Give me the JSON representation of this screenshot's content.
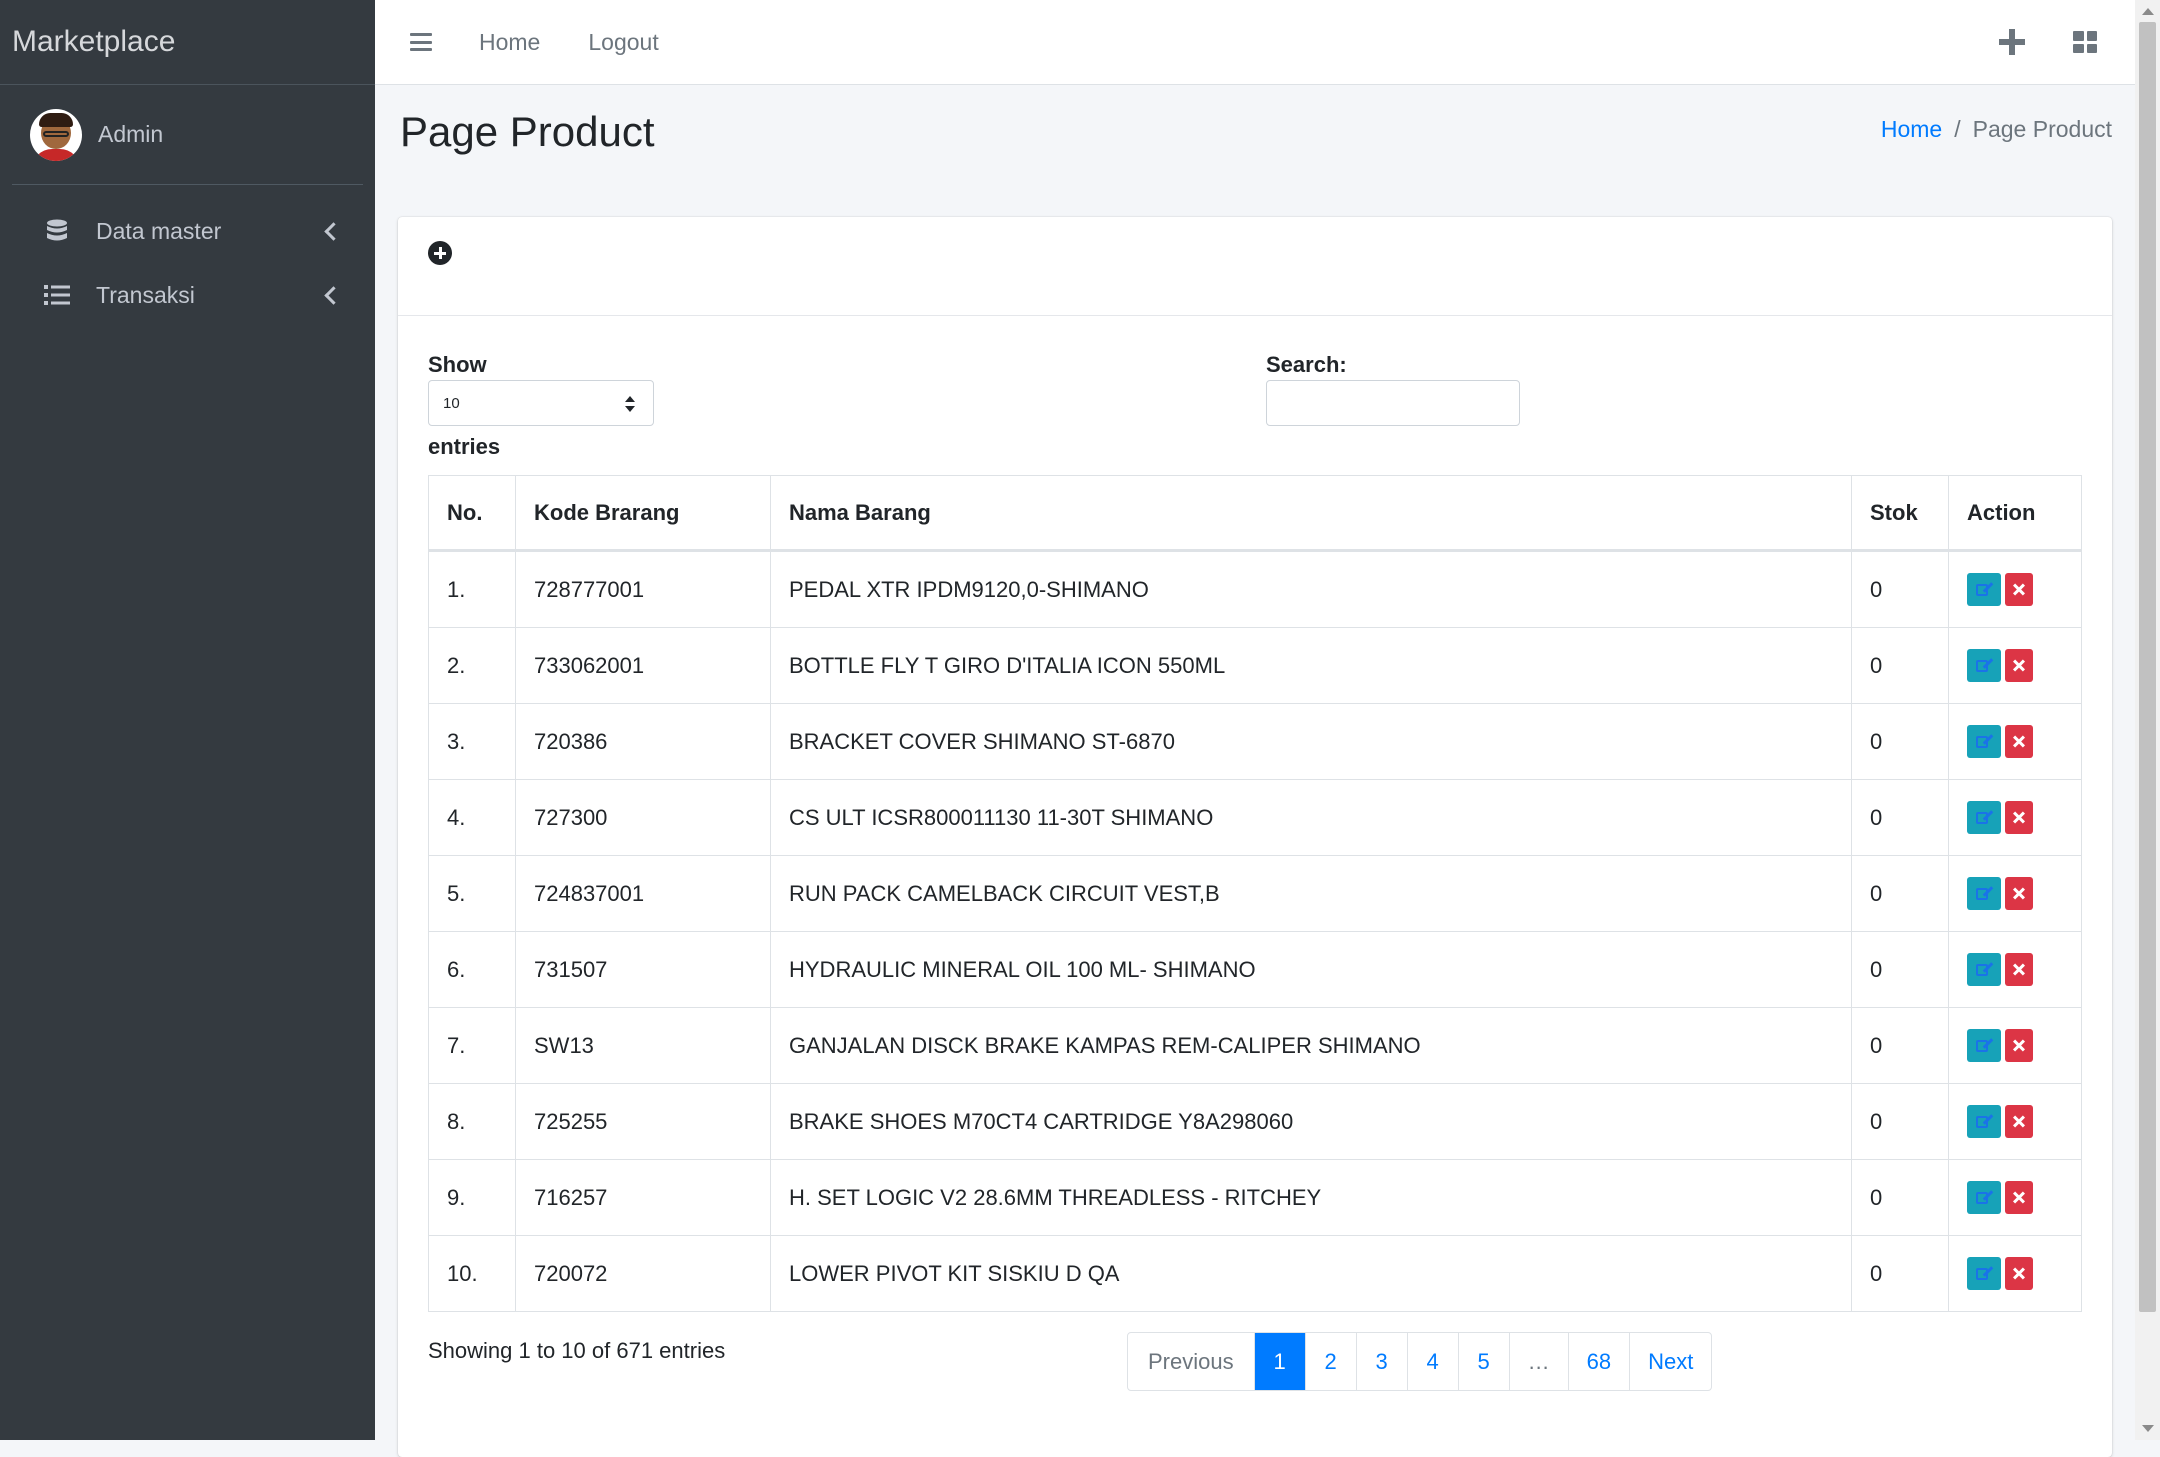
{
  "app": {
    "brand": "Marketplace"
  },
  "user": {
    "name": "Admin"
  },
  "sidebar": {
    "items": [
      {
        "label": "Data master"
      },
      {
        "label": "Transaksi"
      }
    ]
  },
  "topnav": {
    "links": [
      {
        "label": "Home"
      },
      {
        "label": "Logout"
      }
    ]
  },
  "page": {
    "title": "Page Product"
  },
  "breadcrumb": {
    "home": "Home",
    "sep": "/",
    "current": "Page Product"
  },
  "table_controls": {
    "show_label": "Show",
    "length_value": "10",
    "entries_label": "entries",
    "search_label": "Search:",
    "search_value": ""
  },
  "table": {
    "headers": [
      "No.",
      "Kode Brarang",
      "Nama Barang",
      "Stok",
      "Action"
    ],
    "rows": [
      {
        "no": "1.",
        "kode": "728777001",
        "nama": "PEDAL XTR IPDM9120,0-SHIMANO",
        "stok": "0"
      },
      {
        "no": "2.",
        "kode": "733062001",
        "nama": "BOTTLE FLY T GIRO D'ITALIA ICON 550ML",
        "stok": "0"
      },
      {
        "no": "3.",
        "kode": "720386",
        "nama": "BRACKET COVER SHIMANO ST-6870",
        "stok": "0"
      },
      {
        "no": "4.",
        "kode": "727300",
        "nama": "CS ULT ICSR800011130 11-30T SHIMANO",
        "stok": "0"
      },
      {
        "no": "5.",
        "kode": "724837001",
        "nama": "RUN PACK CAMELBACK CIRCUIT VEST,B",
        "stok": "0"
      },
      {
        "no": "6.",
        "kode": "731507",
        "nama": "HYDRAULIC MINERAL OIL 100 ML- SHIMANO",
        "stok": "0"
      },
      {
        "no": "7.",
        "kode": "SW13",
        "nama": "GANJALAN DISCK BRAKE KAMPAS REM-CALIPER SHIMANO",
        "stok": "0"
      },
      {
        "no": "8.",
        "kode": "725255",
        "nama": "BRAKE SHOES M70CT4 CARTRIDGE Y8A298060",
        "stok": "0"
      },
      {
        "no": "9.",
        "kode": "716257",
        "nama": "H. SET LOGIC V2 28.6MM THREADLESS - RITCHEY",
        "stok": "0"
      },
      {
        "no": "10.",
        "kode": "720072",
        "nama": "LOWER PIVOT KIT SISKIU D QA",
        "stok": "0"
      }
    ]
  },
  "footer": {
    "info": "Showing 1 to 10 of 671 entries",
    "pagination": [
      "Previous",
      "1",
      "2",
      "3",
      "4",
      "5",
      "…",
      "68",
      "Next"
    ],
    "active_page": "1"
  },
  "icons": {
    "sidebar_data_master": "database-icon",
    "sidebar_transaksi": "list-icon",
    "menu": "hamburger-icon",
    "fullscreen": "compress-icon",
    "control_sidebar": "th-large-icon",
    "add": "plus-circle-icon",
    "edit": "edit-icon",
    "delete": "times-icon"
  },
  "colors": {
    "sidebar_bg": "#343a40",
    "primary": "#007bff",
    "info": "#17a2b8",
    "danger": "#dc3545"
  }
}
